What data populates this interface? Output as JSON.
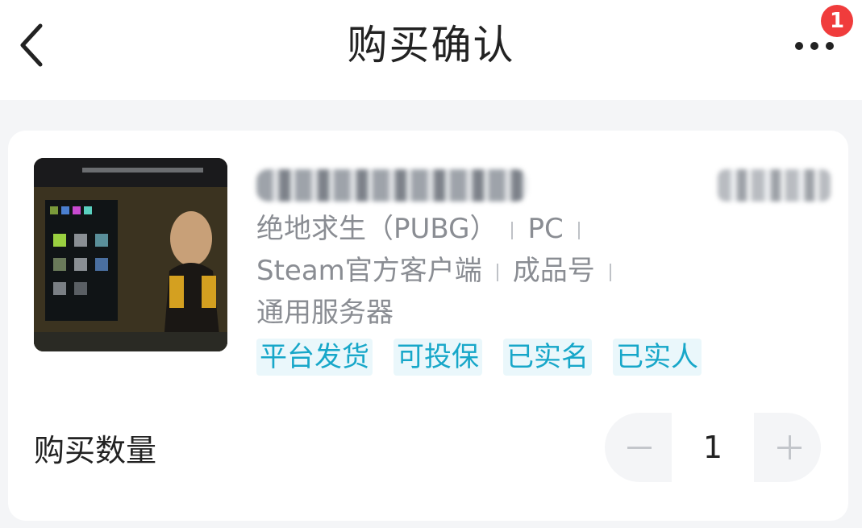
{
  "header": {
    "title": "购买确认",
    "badge_count": "1"
  },
  "product": {
    "specs_line1": [
      "绝地求生（PUBG）",
      "PC"
    ],
    "specs_line2": [
      "Steam官方客户端",
      "成品号"
    ],
    "specs_line3": "通用服务器",
    "tags": [
      "平台发货",
      "可投保",
      "已实名",
      "已实人"
    ]
  },
  "quantity": {
    "label": "购买数量",
    "value": "1"
  },
  "colors": {
    "tag_text": "#17a7c9",
    "badge": "#f03c3c",
    "page_bg": "#f4f5f7"
  },
  "icons": {
    "back": "chevron-left-icon",
    "more": "more-dots-icon",
    "minus": "minus-icon",
    "plus": "plus-icon"
  }
}
